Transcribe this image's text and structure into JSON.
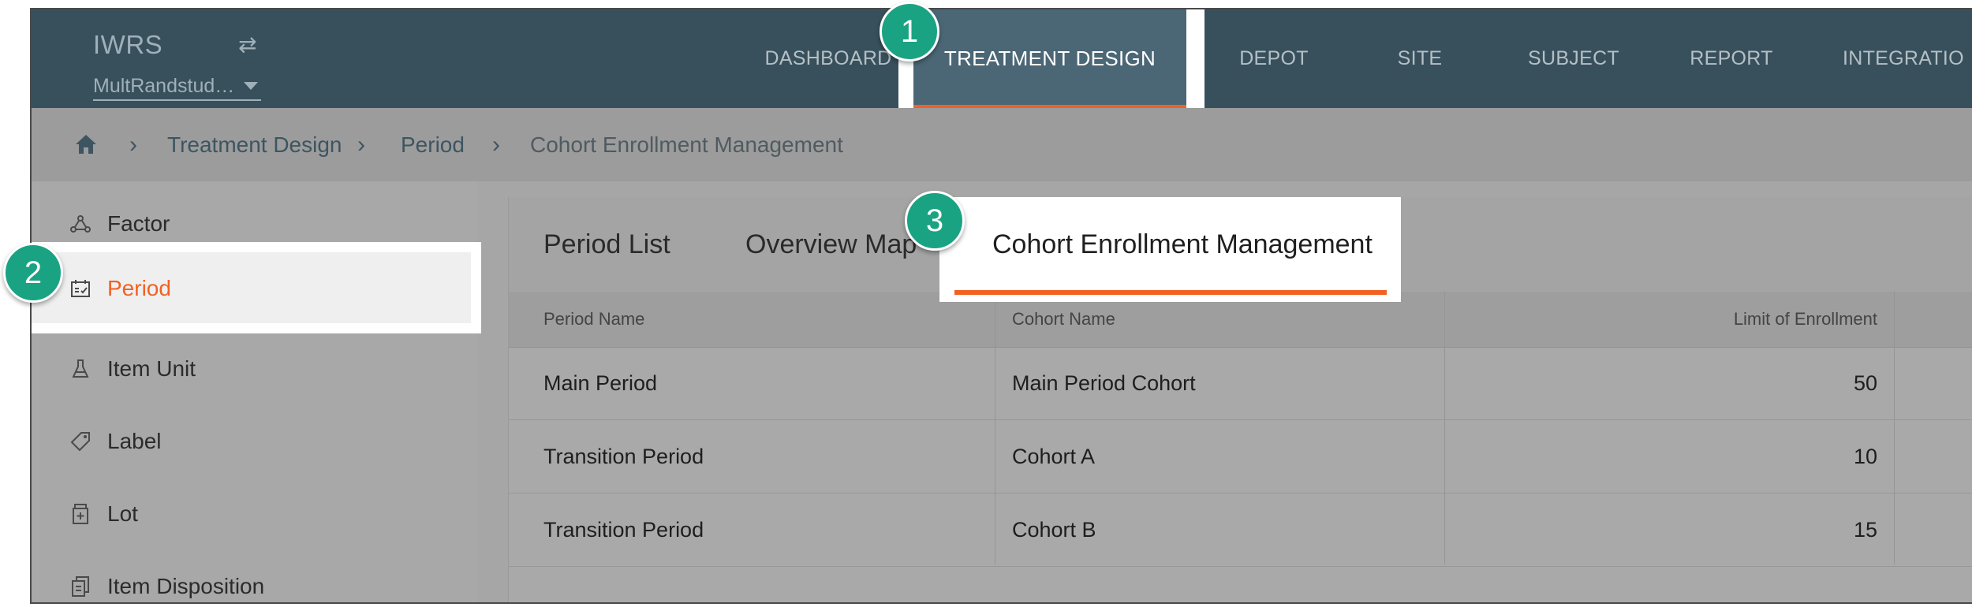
{
  "header": {
    "app_title": "IWRS",
    "study_selector": "MultRandstud…",
    "nav_items": [
      "DASHBOARD",
      "TREATMENT DESIGN",
      "DEPOT",
      "SITE",
      "SUBJECT",
      "REPORT",
      "INTEGRATIO"
    ],
    "active_nav": "TREATMENT DESIGN"
  },
  "breadcrumb": {
    "items": [
      "Treatment Design",
      "Period",
      "Cohort Enrollment Management"
    ]
  },
  "sidebar": {
    "items": [
      {
        "label": "Factor",
        "icon": "factor-icon"
      },
      {
        "label": "Period",
        "icon": "calendar-check-icon"
      },
      {
        "label": "Item Unit",
        "icon": "flask-icon"
      },
      {
        "label": "Label",
        "icon": "tag-icon"
      },
      {
        "label": "Lot",
        "icon": "medicine-bottle-icon"
      },
      {
        "label": "Item Disposition",
        "icon": "documents-icon"
      }
    ],
    "active": "Period"
  },
  "tabs": {
    "items": [
      "Period List",
      "Overview Map",
      "Cohort Enrollment Management"
    ],
    "active": "Cohort Enrollment Management"
  },
  "table": {
    "columns": [
      "Period Name",
      "Cohort Name",
      "Limit of Enrollment"
    ],
    "rows": [
      [
        "Main Period",
        "Main Period Cohort",
        "50"
      ],
      [
        "Transition Period",
        "Cohort A",
        "10"
      ],
      [
        "Transition Period",
        "Cohort B",
        "15"
      ]
    ]
  },
  "steps": [
    "1",
    "2",
    "3"
  ],
  "colors": {
    "header_bg": "#38505c",
    "accent": "#f26122",
    "active_text": "#f26122",
    "step_marker": "#1aa382"
  }
}
